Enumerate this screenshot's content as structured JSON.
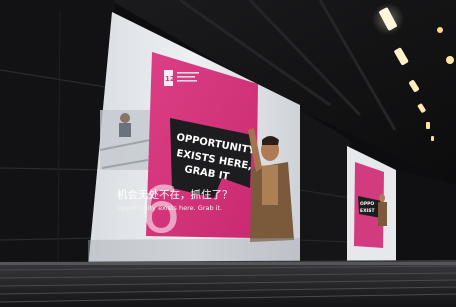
{
  "scene": {
    "colors": {
      "background": "#0b0b0c",
      "screen_light": "#e9ecef",
      "poster_magenta": "#d6347a",
      "poster_dark_block": "#1d1d1f",
      "stage_front": "#2b2b2e",
      "ceiling_light": "#fff6d8"
    }
  },
  "main_screen": {
    "logo_text": "12",
    "poster_lines": [
      "OPPORTUNITY",
      "EXISTS HERE,",
      "GRAB IT"
    ],
    "big_number": "6",
    "caption_zh": "机会无处不在，抓住了？",
    "caption_en": "Opportunity exists here. Grab it."
  },
  "side_screen": {
    "poster_lines": [
      "OPPO",
      "EXIST"
    ]
  }
}
